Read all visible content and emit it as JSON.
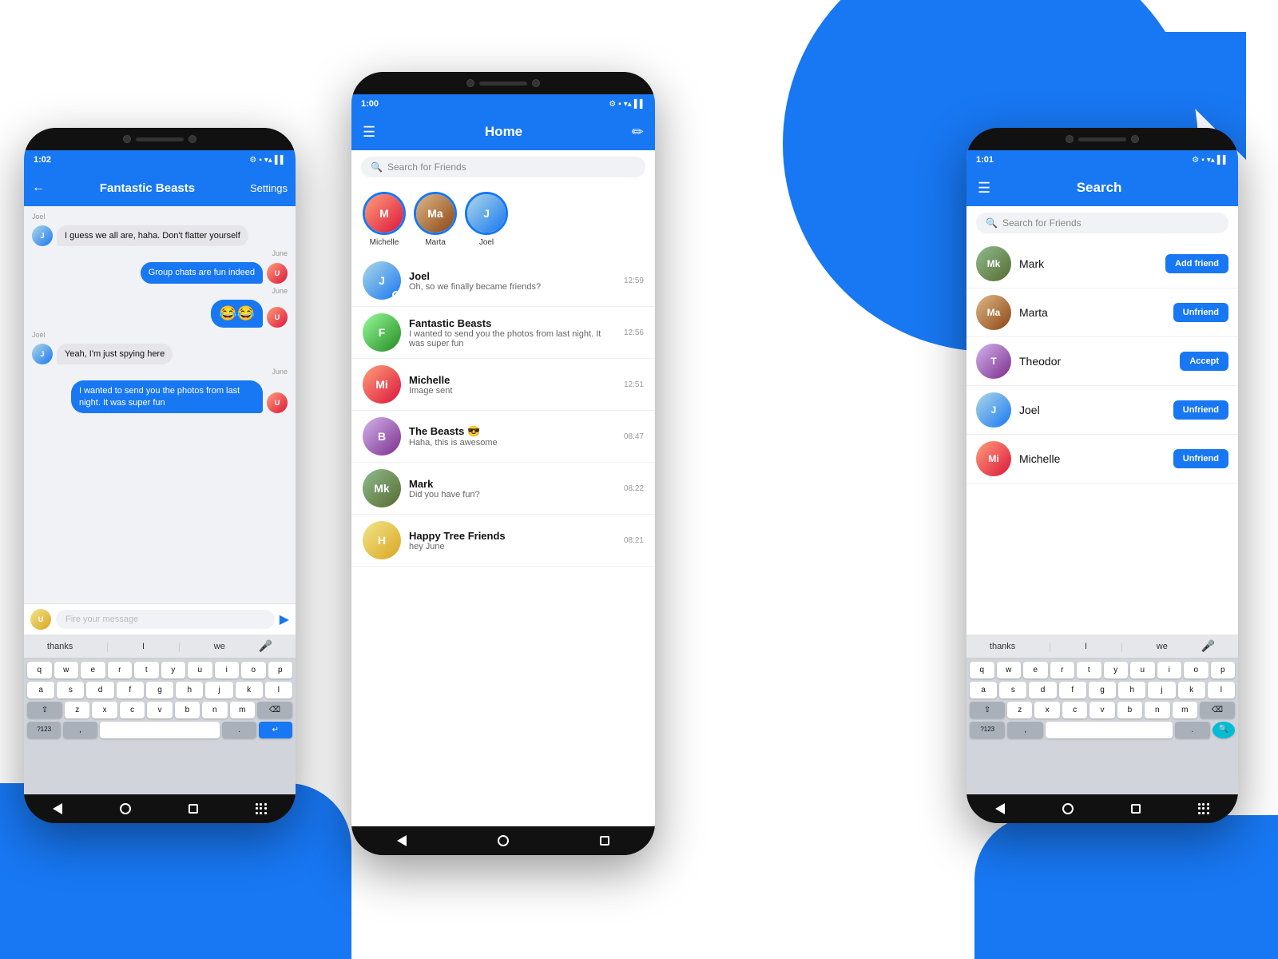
{
  "background": {
    "circle_color": "#1877f2",
    "bottom_left_color": "#1877f2",
    "bottom_right_color": "#1877f2"
  },
  "phone_left": {
    "status_time": "1:02",
    "header_title": "Fantastic Beasts",
    "settings_label": "Settings",
    "messages": [
      {
        "sender": "Joel",
        "text": "I guess we all are, haha. Don't flatter yourself",
        "side": "left",
        "av": "J"
      },
      {
        "sender": "",
        "text": "Group chats are fun indeed",
        "side": "right",
        "date": "June",
        "av": "U"
      },
      {
        "sender": "",
        "text": "😂😂",
        "side": "right",
        "date": "June",
        "av": "U"
      },
      {
        "sender": "Joel",
        "text": "Yeah, I'm just spying here",
        "side": "left",
        "av": "J"
      },
      {
        "sender": "",
        "text": "I wanted to send you the photos from last night. It was super fun",
        "side": "right",
        "date": "June",
        "av": "U"
      }
    ],
    "input_placeholder": "Fire your message",
    "keyboard": {
      "suggestions": [
        "thanks",
        "I",
        "we"
      ],
      "rows": [
        [
          "q",
          "w",
          "e",
          "r",
          "t",
          "y",
          "u",
          "i",
          "o",
          "p"
        ],
        [
          "a",
          "s",
          "d",
          "f",
          "g",
          "h",
          "j",
          "k",
          "l"
        ],
        [
          "z",
          "x",
          "c",
          "v",
          "b",
          "n",
          "m"
        ],
        [
          "?123",
          ",",
          "",
          ".",
          ">"
        ]
      ]
    }
  },
  "phone_center": {
    "status_time": "1:00",
    "header_title": "Home",
    "search_placeholder": "Search for Friends",
    "stories": [
      {
        "name": "Michelle",
        "av": "M",
        "av_class": "av-4"
      },
      {
        "name": "Marta",
        "av": "Ma",
        "av_class": "av-2"
      },
      {
        "name": "Joel",
        "av": "J",
        "av_class": "av-3"
      }
    ],
    "conversations": [
      {
        "name": "Joel",
        "preview": "Oh, so we finally became friends?",
        "time": "12:59",
        "av": "J",
        "av_class": "av-3",
        "online": true
      },
      {
        "name": "Fantastic Beasts",
        "preview": "I wanted to send you the photos from last night. It was super fun",
        "time": "12:56",
        "av": "F",
        "av_class": "av-6"
      },
      {
        "name": "Michelle",
        "preview": "Image sent",
        "time": "12:51",
        "av": "Mi",
        "av_class": "av-4"
      },
      {
        "name": "The Beasts 😎",
        "preview": "Haha, this is awesome",
        "time": "08:47",
        "av": "B",
        "av_class": "av-5"
      },
      {
        "name": "Mark",
        "preview": "Did you have fun?",
        "time": "08:22",
        "av": "Mk",
        "av_class": "av-1"
      },
      {
        "name": "Happy Tree Friends",
        "preview": "hey June",
        "time": "08:21",
        "av": "H",
        "av_class": "av-7"
      }
    ]
  },
  "phone_right": {
    "status_time": "1:01",
    "header_title": "Search",
    "search_placeholder": "Search for Friends",
    "friends": [
      {
        "name": "Mark",
        "av": "Mk",
        "av_class": "av-1",
        "action": "Add friend",
        "btn_class": "btn-add"
      },
      {
        "name": "Marta",
        "av": "Ma",
        "av_class": "av-2",
        "action": "Unfriend",
        "btn_class": "btn-unfriend"
      },
      {
        "name": "Theodor",
        "av": "T",
        "av_class": "av-5",
        "action": "Accept",
        "btn_class": "btn-accept"
      },
      {
        "name": "Joel",
        "av": "J",
        "av_class": "av-3",
        "action": "Unfriend",
        "btn_class": "btn-unfriend"
      },
      {
        "name": "Michelle",
        "av": "Mi",
        "av_class": "av-4",
        "action": "Unfriend",
        "btn_class": "btn-unfriend"
      }
    ],
    "keyboard": {
      "suggestions": [
        "thanks",
        "I",
        "we"
      ]
    }
  }
}
